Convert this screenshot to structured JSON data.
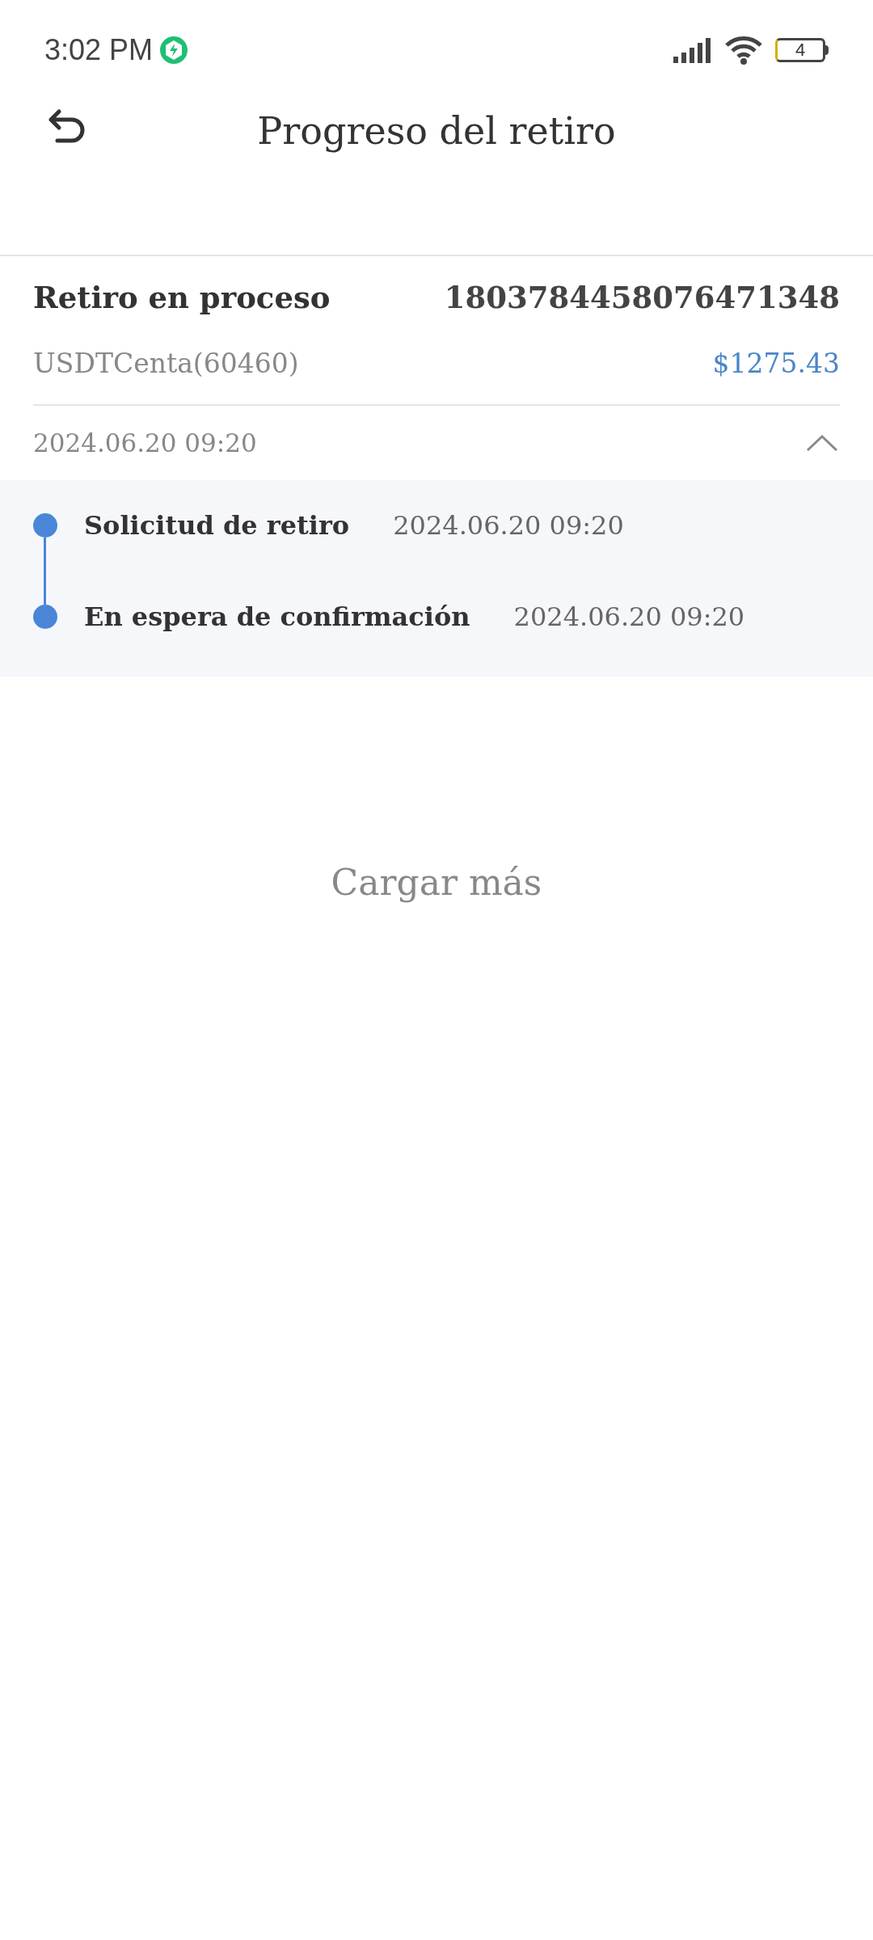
{
  "status_bar": {
    "time": "3:02 PM",
    "battery": "4"
  },
  "header": {
    "title": "Progreso del retiro"
  },
  "withdrawal": {
    "status": "Retiro en proceso",
    "id": "1803784458076471348",
    "account": "USDTCenta(60460)",
    "amount": "$1275.43",
    "date": "2024.06.20 09:20",
    "expanded": true,
    "steps": [
      {
        "label": "Solicitud de retiro",
        "time": "2024.06.20 09:20"
      },
      {
        "label": "En espera de confirmación",
        "time": "2024.06.20 09:20"
      }
    ]
  },
  "load_more": "Cargar más"
}
